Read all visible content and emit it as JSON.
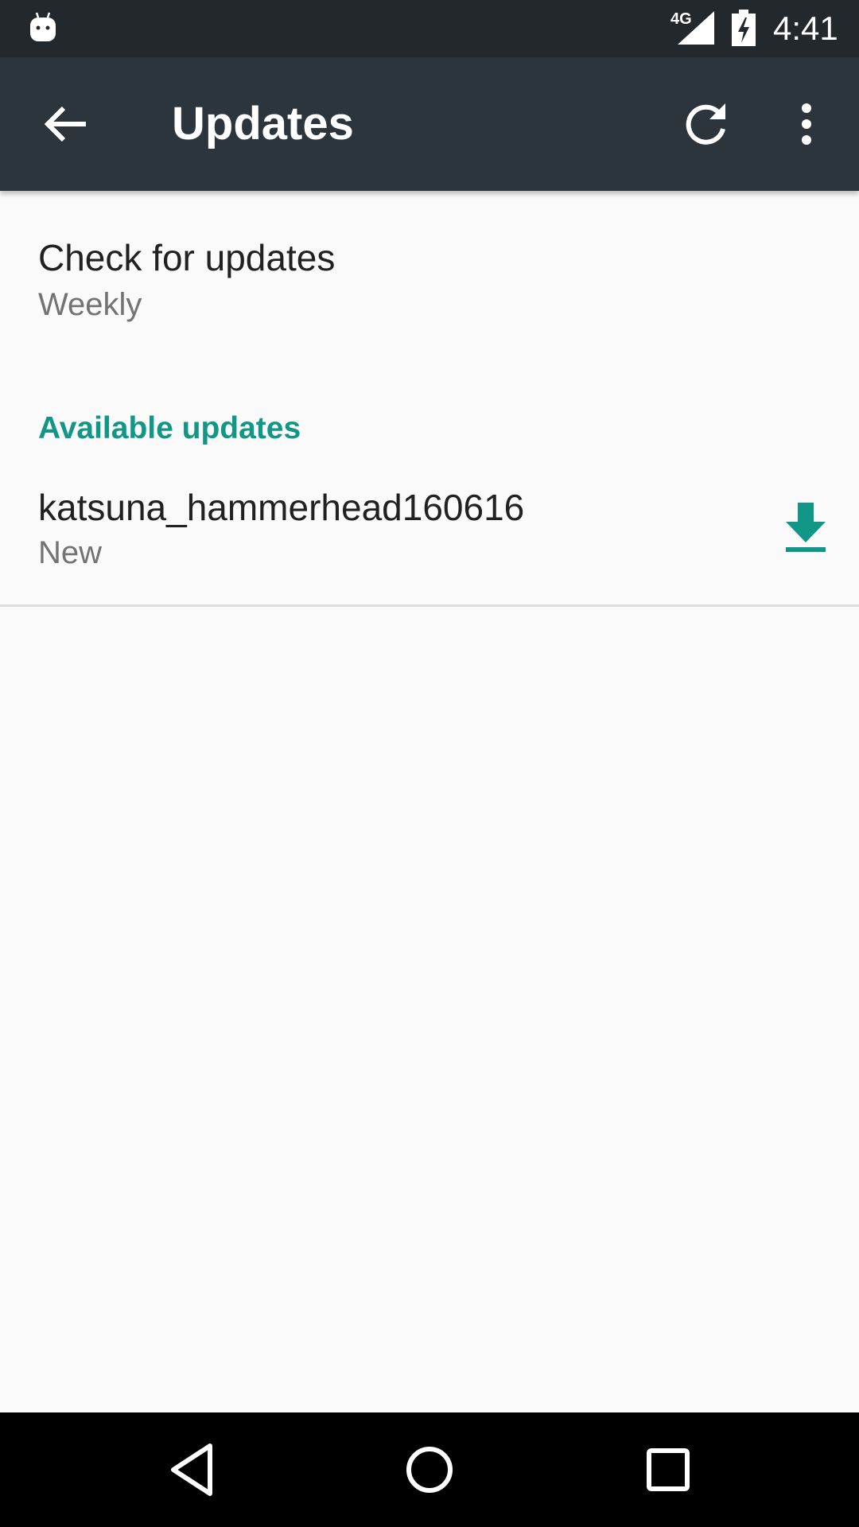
{
  "status_bar": {
    "network": "4G",
    "time": "4:41",
    "icons": [
      "android-notification-icon",
      "signal-icon",
      "battery-charging-icon"
    ]
  },
  "app_bar": {
    "title": "Updates",
    "icons": [
      "back-arrow-icon",
      "refresh-icon",
      "more-vert-icon"
    ]
  },
  "preference": {
    "title": "Check for updates",
    "summary": "Weekly"
  },
  "available": {
    "header": "Available updates",
    "items": [
      {
        "name": "katsuna_hammerhead160616",
        "status": "New",
        "action_icon": "download-icon"
      }
    ]
  },
  "colors": {
    "status_bar": "#22282c",
    "app_bar": "#2b353b",
    "accent": "#129685",
    "background": "#fafafa",
    "nav_bar": "#000000"
  },
  "nav_bar": {
    "icons": [
      "nav-back-icon",
      "nav-home-icon",
      "nav-recents-icon"
    ]
  }
}
